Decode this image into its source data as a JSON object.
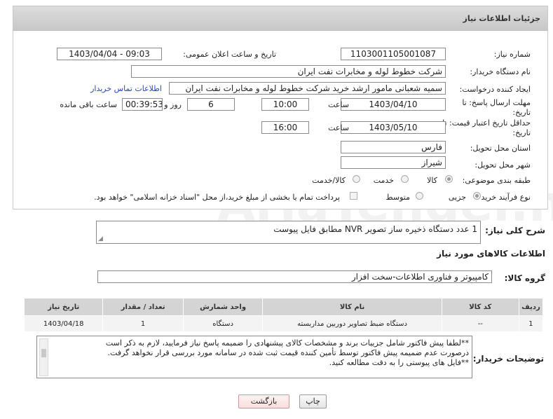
{
  "header": {
    "title": "جزئیات اطلاعات نیاز"
  },
  "fields": {
    "need_number_label": "شماره نیاز:",
    "need_number": "1103001105001087",
    "announce_label": "تاریخ و ساعت اعلان عمومی:",
    "announce_value": "1403/04/04 - 09:03",
    "buyer_label": "نام دستگاه خریدار:",
    "buyer_value": "شرکت خطوط لوله و مخابرات نفت ایران",
    "creator_label": "ایجاد کننده درخواست:",
    "creator_value": "سمیه شعبانی مامور ارشد خرید  شرکت خطوط لوله و مخابرات نفت ایران",
    "contact_link": "اطلاعات تماس خریدار",
    "deadline_label_1": "مهلت ارسال پاسخ: تا",
    "deadline_label_2": "تاریخ:",
    "deadline_date": "1403/04/10",
    "time_label": "ساعت",
    "deadline_time": "10:00",
    "days_value": "6",
    "days_label": "روز و",
    "remaining_time": "00:39:53",
    "remaining_label": "ساعت باقی مانده",
    "validity_label_1": "حداقل تاریخ اعتبار قیمت: تا",
    "validity_label_2": "تاریخ:",
    "validity_date": "1403/05/10",
    "validity_time": "16:00",
    "province_label": "استان محل تحویل:",
    "province_value": "فارس",
    "city_label": "شهر محل تحویل:",
    "city_value": "شیراز",
    "category_label": "طبقه بندی موضوعی:",
    "category_options": [
      "کالا",
      "خدمت",
      "کالا/خدمت"
    ],
    "purchase_label": "نوع فرآیند خرید :",
    "purchase_options": [
      "جزیی",
      "متوسط"
    ],
    "payment_note": "پرداخت تمام یا بخشی از مبلغ خرید،از محل \"اسناد خزانه اسلامی\" خواهد بود."
  },
  "description": {
    "label": "شرح کلی نیاز:",
    "value": "1 عدد دستگاه ذخیره ساز تصویر NVR مطابق فایل پیوست"
  },
  "goods_section": {
    "title": "اطلاعات کالاهای مورد نیاز",
    "group_label": "گروه کالا:",
    "group_value": "کامپیوتر و فناوری اطلاعات-سخت افزار"
  },
  "table": {
    "headers": [
      "ردیف",
      "کد کالا",
      "نام کالا",
      "واحد شمارش",
      "تعداد / مقدار",
      "تاریخ نیاز"
    ],
    "rows": [
      [
        "1",
        "--",
        "دستگاه ضبط تصاویر دوربین مداربسته",
        "دستگاه",
        "1",
        "1403/04/18"
      ]
    ]
  },
  "buyer_notes": {
    "label": "توضیحات خریدار:",
    "line1": "**لطفا پیش فاکتور شامل جزییات برند و مشخصات کالای پیشنهادی را ضمیمه پاسخ نیاز فرمایید، لازم به ذکر است",
    "line2": "درصورت عدم ضمیمه پیش فاکتور توسط تأمین کننده قیمت ثبت شده در سامانه مورد بررسی قرار نخواهد گرفت.",
    "line3": "**فایل های پیوستی را به دقت مطالعه کنید."
  },
  "buttons": {
    "print": "چاپ",
    "back": "بازگشت"
  },
  "watermark": "AriaTender.neT"
}
